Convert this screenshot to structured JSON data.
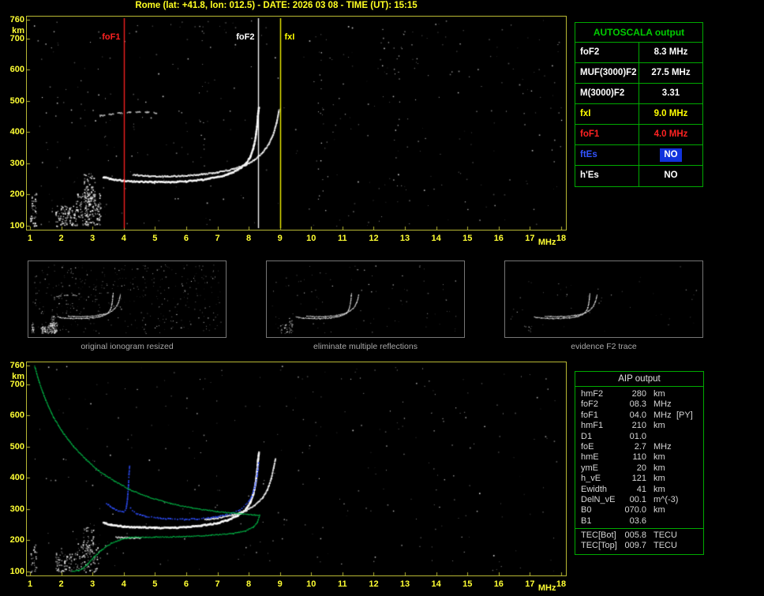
{
  "header": {
    "title": "Rome (lat: +41.8, lon: 012.5) - DATE: 2026 03 08 - TIME (UT): 15:15"
  },
  "colors": {
    "axis_frame": "#b8b834",
    "tick_label": "#ffff33",
    "table_border": "#00aa00",
    "autoscala_title": "#00cc00",
    "fof1_red": "#ff2222",
    "fof2_white": "#ffffff",
    "fxi_yellow": "#ffff00",
    "es_blue": "#3355ff",
    "es_blue_bg": "#1133dd",
    "trace_blue": "#2e4fff",
    "profile_green": "#00c44c",
    "caption_gray": "#a8a8a8"
  },
  "axes": {
    "x_ticks": [
      1,
      2,
      3,
      4,
      5,
      6,
      7,
      8,
      9,
      10,
      11,
      12,
      13,
      14,
      15,
      16,
      17,
      18
    ],
    "x_unit": "MHz",
    "y_ticks": [
      760,
      700,
      600,
      500,
      400,
      300,
      200,
      100
    ],
    "y_unit": "km",
    "freq_range": [
      1,
      18
    ],
    "km_range": [
      100,
      760
    ]
  },
  "markers": [
    {
      "label": "foF1",
      "freq": 4.0,
      "side": "left",
      "color": "#ff2222"
    },
    {
      "label": "foF2",
      "freq": 8.3,
      "side": "left",
      "color": "#ffffff"
    },
    {
      "label": "fxI",
      "freq": 9.0,
      "side": "right",
      "color": "#ffff00"
    }
  ],
  "autoscala": {
    "title": "AUTOSCALA output",
    "rows": [
      {
        "label": "foF2",
        "value": "8.3 MHz",
        "color": "#ffffff"
      },
      {
        "label": "MUF(3000)F2",
        "value": "27.5 MHz",
        "color": "#ffffff"
      },
      {
        "label": "M(3000)F2",
        "value": "3.31",
        "color": "#ffffff"
      },
      {
        "label": "fxI",
        "value": "9.0 MHz",
        "color": "#ffff00"
      },
      {
        "label": "foF1",
        "value": "4.0 MHz",
        "color": "#ff2222"
      },
      {
        "label": "ftEs",
        "value": "NO",
        "color": "#3355ff",
        "value_color": "#ffffff",
        "value_bg": "#1133dd"
      },
      {
        "label": "h'Es",
        "value": "NO",
        "color": "#ffffff"
      }
    ]
  },
  "thumbnails": [
    {
      "caption": "original ionogram resized"
    },
    {
      "caption": "eliminate multiple reflections"
    },
    {
      "caption": "evidence F2 trace"
    }
  ],
  "aip": {
    "title": "AIP output",
    "rows": [
      {
        "name": "hmF2",
        "value": "280",
        "unit": "km",
        "extra": ""
      },
      {
        "name": "foF2",
        "value": "08.3",
        "unit": "MHz",
        "extra": ""
      },
      {
        "name": "foF1",
        "value": "04.0",
        "unit": "MHz",
        "extra": "[PY]"
      },
      {
        "name": "hmF1",
        "value": "210",
        "unit": "km",
        "extra": ""
      },
      {
        "name": "D1",
        "value": "01.0",
        "unit": "",
        "extra": ""
      },
      {
        "name": "foE",
        "value": "2.7",
        "unit": "MHz",
        "extra": ""
      },
      {
        "name": "hmE",
        "value": "110",
        "unit": "km",
        "extra": ""
      },
      {
        "name": "ymE",
        "value": "20",
        "unit": "km",
        "extra": ""
      },
      {
        "name": "h_vE",
        "value": "121",
        "unit": "km",
        "extra": ""
      },
      {
        "name": "Ewidth",
        "value": "41",
        "unit": "km",
        "extra": ""
      },
      {
        "name": "DelN_vE",
        "value": "00.1",
        "unit": "m^(-3)",
        "extra": ""
      },
      {
        "name": "B0",
        "value": "070.0",
        "unit": "km",
        "extra": ""
      },
      {
        "name": "B1",
        "value": "03.6",
        "unit": "",
        "extra": ""
      }
    ],
    "tec_rows": [
      {
        "name": "TEC[Bot]",
        "value": "005.8",
        "unit": "TECU"
      },
      {
        "name": "TEC[Top]",
        "value": "009.7",
        "unit": "TECU"
      }
    ]
  },
  "chart_data": {
    "main_ionogram": {
      "type": "scatter",
      "xlabel": "MHz",
      "ylabel": "km",
      "xlim": [
        1,
        18
      ],
      "ylim": [
        100,
        760
      ],
      "seed": 11,
      "traces": [
        {
          "name": "F-trace-o-mode",
          "color": "#ffffff",
          "width": 2.3,
          "style": "solid",
          "points": [
            [
              3.35,
              256
            ],
            [
              3.6,
              249
            ],
            [
              4.0,
              244
            ],
            [
              4.5,
              241
            ],
            [
              5.0,
              240
            ],
            [
              5.5,
              240
            ],
            [
              6.0,
              242
            ],
            [
              6.5,
              247
            ],
            [
              7.0,
              255
            ],
            [
              7.35,
              265
            ],
            [
              7.65,
              279
            ],
            [
              7.9,
              297
            ],
            [
              8.05,
              320
            ],
            [
              8.15,
              348
            ],
            [
              8.22,
              382
            ],
            [
              8.27,
              420
            ],
            [
              8.3,
              458
            ],
            [
              8.33,
              480
            ]
          ]
        },
        {
          "name": "F-trace-x-mode",
          "color": "#f0f0f0",
          "width": 1.9,
          "style": "solid",
          "points": [
            [
              4.3,
              263
            ],
            [
              4.8,
              259
            ],
            [
              5.4,
              258
            ],
            [
              6.0,
              260
            ],
            [
              6.5,
              264
            ],
            [
              7.0,
              271
            ],
            [
              7.5,
              281
            ],
            [
              7.9,
              294
            ],
            [
              8.2,
              312
            ],
            [
              8.45,
              334
            ],
            [
              8.65,
              362
            ],
            [
              8.8,
              396
            ],
            [
              8.9,
              432
            ],
            [
              8.97,
              470
            ]
          ]
        },
        {
          "name": "second-hop",
          "color": "#cccccc",
          "width": 1.6,
          "style": "dash",
          "points": [
            [
              3.25,
              452
            ],
            [
              3.7,
              459
            ],
            [
              4.2,
              463
            ],
            [
              4.75,
              464
            ],
            [
              5.05,
              461
            ]
          ]
        }
      ],
      "noise": [
        {
          "n": 100,
          "f": [
            1.8,
            2.45
          ],
          "km": [
            100,
            165
          ],
          "size": 1.6
        },
        {
          "n": 170,
          "f": [
            2.45,
            3.25
          ],
          "km": [
            100,
            205
          ],
          "size": 1.6
        },
        {
          "n": 80,
          "f": [
            2.7,
            3.08
          ],
          "km": [
            170,
            268
          ],
          "size": 1.5
        },
        {
          "n": 50,
          "f": [
            1.0,
            1.2
          ],
          "km": [
            100,
            205
          ],
          "size": 1.5
        },
        {
          "n": 18,
          "f": [
            10.2,
            10.5
          ],
          "km": [
            150,
            700
          ],
          "size": 1.2
        },
        {
          "n": 16,
          "f": [
            12.6,
            12.9
          ],
          "km": [
            120,
            700
          ],
          "size": 1.2
        },
        {
          "n": 14,
          "f": [
            6.4,
            6.6
          ],
          "km": [
            320,
            740
          ],
          "size": 1.2
        }
      ],
      "speckle": {
        "n": 380,
        "size": 1.3
      }
    },
    "profile_ionogram": {
      "type": "scatter",
      "xlabel": "MHz",
      "ylabel": "km",
      "xlim": [
        1,
        18
      ],
      "ylim": [
        100,
        760
      ],
      "seed": 23,
      "traces": [
        {
          "name": "F-trace-o-mode",
          "color": "#ffffff",
          "width": 2.4,
          "style": "solid",
          "points": [
            [
              3.35,
              256
            ],
            [
              3.6,
              249
            ],
            [
              4.0,
              244
            ],
            [
              4.5,
              241
            ],
            [
              5.0,
              240
            ],
            [
              5.5,
              240
            ],
            [
              6.0,
              242
            ],
            [
              6.5,
              247
            ],
            [
              7.0,
              255
            ],
            [
              7.35,
              265
            ],
            [
              7.65,
              279
            ],
            [
              7.9,
              297
            ],
            [
              8.05,
              320
            ],
            [
              8.15,
              348
            ],
            [
              8.22,
              382
            ],
            [
              8.27,
              420
            ],
            [
              8.3,
              458
            ],
            [
              8.33,
              480
            ]
          ]
        },
        {
          "name": "F-trace-x-mode",
          "color": "#f0f0f0",
          "width": 1.8,
          "style": "solid",
          "points": [
            [
              6.6,
              266
            ],
            [
              7.0,
              271
            ],
            [
              7.5,
              281
            ],
            [
              7.9,
              294
            ],
            [
              8.2,
              312
            ],
            [
              8.45,
              336
            ],
            [
              8.6,
              362
            ],
            [
              8.72,
              396
            ],
            [
              8.8,
              432
            ],
            [
              8.86,
              462
            ]
          ]
        },
        {
          "name": "F1-restored-segment",
          "color": "#e8e8e8",
          "width": 1.6,
          "style": "solid",
          "points": [
            [
              3.75,
              209
            ],
            [
              4.55,
              207
            ]
          ]
        },
        {
          "name": "restored-trace-blue-cusp",
          "color": "#2e4fff",
          "width": 1.7,
          "style": "dot",
          "points": [
            [
              3.45,
              318
            ],
            [
              3.65,
              303
            ],
            [
              3.85,
              292
            ],
            [
              4.0,
              290
            ],
            [
              4.08,
              302
            ],
            [
              4.12,
              332
            ],
            [
              4.15,
              372
            ],
            [
              4.17,
              412
            ],
            [
              4.19,
              438
            ]
          ]
        },
        {
          "name": "restored-trace-blue",
          "color": "#2e4fff",
          "width": 1.7,
          "style": "dot",
          "points": [
            [
              4.22,
              302
            ],
            [
              4.4,
              286
            ],
            [
              4.7,
              277
            ],
            [
              5.0,
              272
            ],
            [
              5.5,
              268
            ],
            [
              6.0,
              267
            ],
            [
              6.5,
              269
            ],
            [
              7.0,
              275
            ],
            [
              7.4,
              284
            ],
            [
              7.7,
              297
            ],
            [
              7.95,
              317
            ],
            [
              8.1,
              342
            ],
            [
              8.2,
              372
            ],
            [
              8.27,
              408
            ],
            [
              8.32,
              448
            ]
          ]
        },
        {
          "name": "electron-density-profile-topside",
          "color": "#00c44c",
          "width": 1.3,
          "style": "solid",
          "points": [
            [
              1.15,
              758
            ],
            [
              1.3,
              705
            ],
            [
              1.5,
              650
            ],
            [
              1.75,
              595
            ],
            [
              2.05,
              545
            ],
            [
              2.4,
              500
            ],
            [
              2.8,
              458
            ],
            [
              3.2,
              422
            ],
            [
              3.7,
              390
            ],
            [
              4.2,
              362
            ],
            [
              4.8,
              338
            ],
            [
              5.5,
              318
            ],
            [
              6.2,
              303
            ],
            [
              7.0,
              292
            ],
            [
              7.7,
              285
            ],
            [
              8.2,
              281
            ],
            [
              8.35,
              280
            ]
          ]
        },
        {
          "name": "electron-density-profile-bottomside",
          "color": "#00c44c",
          "width": 1.3,
          "style": "solid",
          "points": [
            [
              8.35,
              280
            ],
            [
              8.28,
              258
            ],
            [
              8.15,
              242
            ],
            [
              7.9,
              230
            ],
            [
              7.5,
              222
            ],
            [
              6.8,
              216
            ],
            [
              6.0,
              212
            ],
            [
              5.0,
              210
            ],
            [
              4.2,
              209
            ],
            [
              3.9,
              202
            ],
            [
              3.6,
              190
            ],
            [
              3.3,
              170
            ],
            [
              3.05,
              146
            ],
            [
              2.85,
              124
            ],
            [
              2.7,
              110
            ],
            [
              2.55,
              103
            ],
            [
              2.35,
              100
            ]
          ]
        }
      ],
      "noise": [
        {
          "n": 80,
          "f": [
            1.8,
            2.5
          ],
          "km": [
            100,
            160
          ],
          "size": 1.5
        },
        {
          "n": 90,
          "f": [
            2.5,
            3.2
          ],
          "km": [
            100,
            195
          ],
          "size": 1.5
        },
        {
          "n": 40,
          "f": [
            2.7,
            3.05
          ],
          "km": [
            160,
            250
          ],
          "size": 1.4
        },
        {
          "n": 30,
          "f": [
            1.0,
            1.2
          ],
          "km": [
            100,
            195
          ],
          "size": 1.4
        }
      ],
      "speckle": {
        "n": 300,
        "size": 1.3
      }
    },
    "thumbs": [
      {
        "seed": 31,
        "use_main_traces": [
          0,
          1,
          2
        ],
        "trace_width": 1.1,
        "noise": [
          {
            "n": 60,
            "f": [
              1.8,
              2.45
            ],
            "km": [
              100,
              165
            ],
            "size": 1.1
          },
          {
            "n": 90,
            "f": [
              2.45,
              3.25
            ],
            "km": [
              100,
              205
            ],
            "size": 1.1
          },
          {
            "n": 45,
            "f": [
              2.7,
              3.08
            ],
            "km": [
              170,
              268
            ],
            "size": 1.0
          },
          {
            "n": 25,
            "f": [
              1.0,
              1.2
            ],
            "km": [
              100,
              205
            ],
            "size": 1.0
          }
        ],
        "speckle": {
          "n": 430,
          "size": 1.0
        }
      },
      {
        "seed": 37,
        "use_main_traces": [
          0,
          1
        ],
        "trace_width": 1.1,
        "noise": [
          {
            "n": 35,
            "f": [
              1.9,
              3.2
            ],
            "km": [
              100,
              190
            ],
            "size": 1.0
          },
          {
            "n": 15,
            "f": [
              2.7,
              3.0
            ],
            "km": [
              160,
              250
            ],
            "size": 1.0
          }
        ],
        "speckle": {
          "n": 90,
          "size": 1.0
        }
      },
      {
        "seed": 41,
        "use_main_traces": [
          0,
          1
        ],
        "trace_width": 1.1,
        "noise": [
          {
            "n": 10,
            "f": [
              2.2,
              3.1
            ],
            "km": [
              100,
              170
            ],
            "size": 1.0
          }
        ],
        "speckle": {
          "n": 45,
          "size": 1.0
        }
      }
    ]
  }
}
